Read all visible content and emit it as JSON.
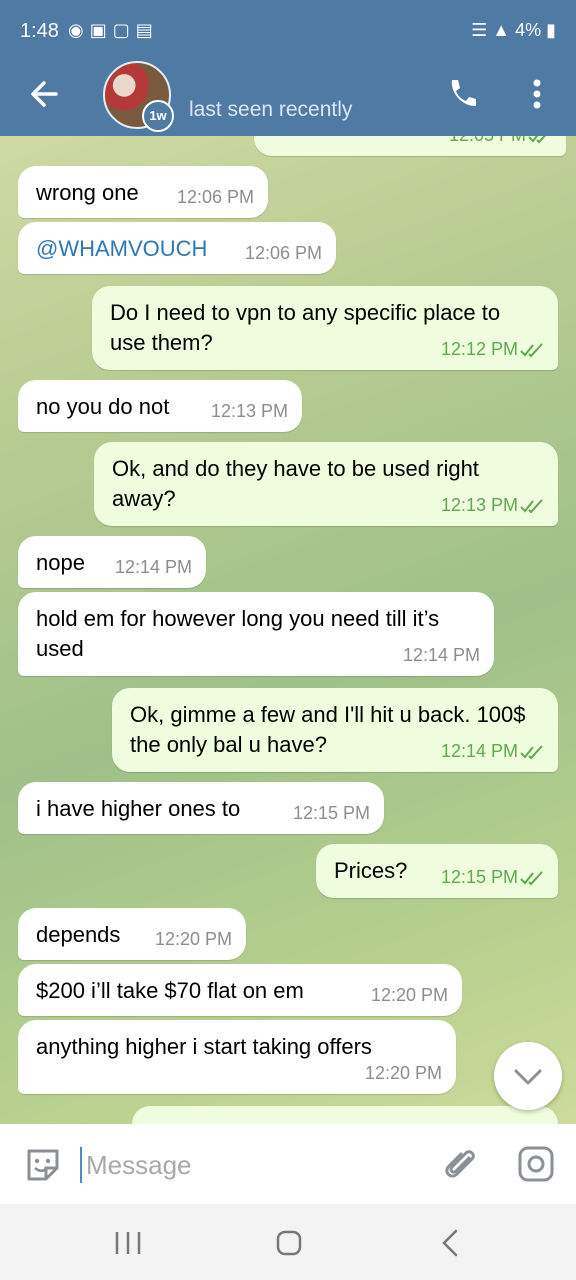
{
  "status_bar": {
    "time": "1:48",
    "battery": "4%"
  },
  "header": {
    "story_badge": "1w",
    "last_seen": "last seen recently"
  },
  "messages": [
    {
      "dir": "out",
      "text": "...",
      "time": "12:05 PM"
    },
    {
      "dir": "in",
      "text": "wrong one",
      "time": "12:06 PM"
    },
    {
      "dir": "in",
      "text": "@WHAMVOUCH",
      "time": "12:06 PM",
      "mention": true
    },
    {
      "dir": "out",
      "text": "Do I need to vpn to any specific place to use them?",
      "time": "12:12 PM"
    },
    {
      "dir": "in",
      "text": "no you do not",
      "time": "12:13 PM"
    },
    {
      "dir": "out",
      "text": "Ok, and do they have to be used right away?",
      "time": "12:13 PM"
    },
    {
      "dir": "in",
      "text": "nope",
      "time": "12:14 PM"
    },
    {
      "dir": "in",
      "text": "hold em for however long you need till it’s used",
      "time": "12:14 PM"
    },
    {
      "dir": "out",
      "text": "Ok, gimme a few and I'll hit u back. 100$ the only bal u have?",
      "time": "12:14 PM"
    },
    {
      "dir": "in",
      "text": "i have higher ones to",
      "time": "12:15 PM"
    },
    {
      "dir": "out",
      "text": "Prices?",
      "time": "12:15 PM"
    },
    {
      "dir": "in",
      "text": "depends",
      "time": "12:20 PM"
    },
    {
      "dir": "in",
      "text": "$200 i’ll take $70 flat on em",
      "time": "12:20 PM"
    },
    {
      "dir": "in",
      "text": "anything higher i start taking offers",
      "time": "12:20 PM"
    }
  ],
  "composer": {
    "placeholder": "Message"
  },
  "icons": {
    "back": "arrow-left-icon",
    "call": "phone-icon",
    "menu": "kebab-menu-icon",
    "emoji": "sticker-emoji-icon",
    "attach": "paperclip-icon",
    "camera": "instagram-camera-icon",
    "scroll_down": "chevron-down-icon"
  },
  "colors": {
    "header": "#4f7aa3",
    "outgoing_bubble": "#effdde",
    "incoming_bubble": "#ffffff",
    "read_check": "#5fa94e"
  }
}
